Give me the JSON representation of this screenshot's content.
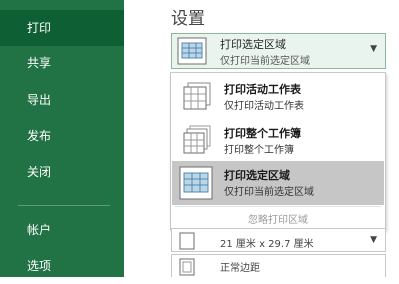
{
  "sidebar": {
    "items": [
      {
        "label": "打印",
        "active": true
      },
      {
        "label": "共享"
      },
      {
        "label": "导出"
      },
      {
        "label": "发布"
      },
      {
        "label": "关闭"
      },
      {
        "label": "帐户"
      },
      {
        "label": "选项"
      }
    ]
  },
  "main": {
    "heading": "设置",
    "dropdown": {
      "title": "打印选定区域",
      "subtitle": "仅打印当前选定区域",
      "icon": "print-selection-icon",
      "caret": "chevron-down-icon"
    },
    "menu": {
      "options": [
        {
          "title": "打印活动工作表",
          "subtitle": "仅打印活动工作表",
          "icon": "active-sheets-icon"
        },
        {
          "title": "打印整个工作簿",
          "subtitle": "打印整个工作簿",
          "icon": "entire-workbook-icon"
        },
        {
          "title": "打印选定区域",
          "subtitle": "仅打印当前选定区域",
          "icon": "print-selection-icon",
          "selected": true
        }
      ],
      "ignore_label": "忽略打印区域"
    },
    "paper_size": "21 厘米 x 29.7 厘米",
    "margins": "正常边距"
  },
  "colors": {
    "sidebar": "#217346",
    "sidebar_active": "#0f5f35",
    "selected_option": "#c6c6c6"
  }
}
